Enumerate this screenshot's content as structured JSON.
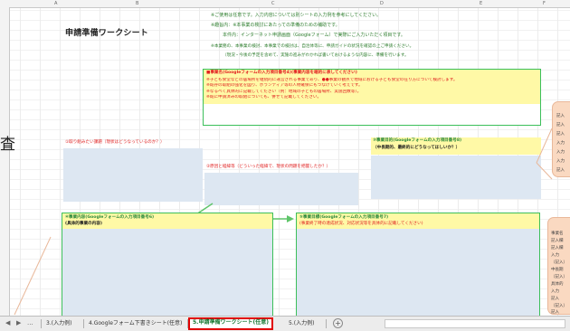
{
  "sheet": {
    "title": "申請準備ワークシート",
    "column_letters": [
      "A",
      "B",
      "C",
      "D",
      "E",
      "F"
    ],
    "notes": [
      "※ご使用は任意です。入力内容については別シートの入力例を参考にしてください。",
      "※趣旨内：※本事業の検討にあたっての準備のための補助です。",
      "本件内：インターネット申請画面（Googleフォーム）で実際にご入力いただく項目です。",
      "※本業務の、本事業の検討、本事業での検討は、自治体等に、申請ガイドの状況を確認の上ご申請ください。",
      "（現況・今後の予定を含めて、実施の進みがわかれば書いておけるような内容に、準備を行います。"
    ],
    "top_box": {
      "heading": "■事業名(Googleフォームの入力項目番号4)(事業内容を端的に表してください)",
      "lines": [
        "※子ども食堂などの居場所を継続的に運営される事業であり、●●事業の観点で地域における子ども食堂の在り方について検討します。",
        "※既存の取組の強化を図り、ボランティア等の人材確保にもつなげていく考えです。",
        "※なるべく具体的に記載してください（例：地域の子どもの居場所、実施回数等）。",
        "※既に申請済みの取組についても、併せて記載してください。"
      ]
    },
    "current_state_label": "①取り組みたい課題（現状はどうなっているのか？）",
    "cause_label": "②原因と経緯等（どういった経緯で、現状の問題を把握したか？）",
    "goal_label": "③事業目的(Googleフォームの入力項目番号8)",
    "goal_sub": "（中長期的、最終的にどうなってほしいか？）",
    "content_label": "④事業内容(Googleフォームの入力項目番号6)",
    "content_sub": "(具体的事業の内容)",
    "target_label": "⑤事業目標(Googleフォームの入力項目番号7)",
    "target_sub": "(事業終了時の達成状況、対応状況等を具体的に記載してください)",
    "right_panel_text": [
      "記入",
      "記入",
      "記入",
      "入力",
      "入力",
      "入力",
      "記入"
    ],
    "right_panel2_text": [
      "事業名",
      "記入欄",
      "記入欄",
      "入力",
      "（記入）",
      "中長期",
      "（記入）",
      "具体的",
      "入力",
      "記入",
      "（記入）",
      "記入"
    ],
    "left_glyph": "査"
  },
  "tabs": {
    "nav_prev": "◀",
    "nav_next": "▶",
    "ellipsis": "...",
    "items": [
      {
        "label": "3.(入力例)"
      },
      {
        "label": "4.Googleフォーム下書きシート(任意)"
      },
      {
        "label": "5.申請準備ワークシート(任意)"
      },
      {
        "label": "5.(入力例)"
      }
    ],
    "add_label": "+"
  }
}
